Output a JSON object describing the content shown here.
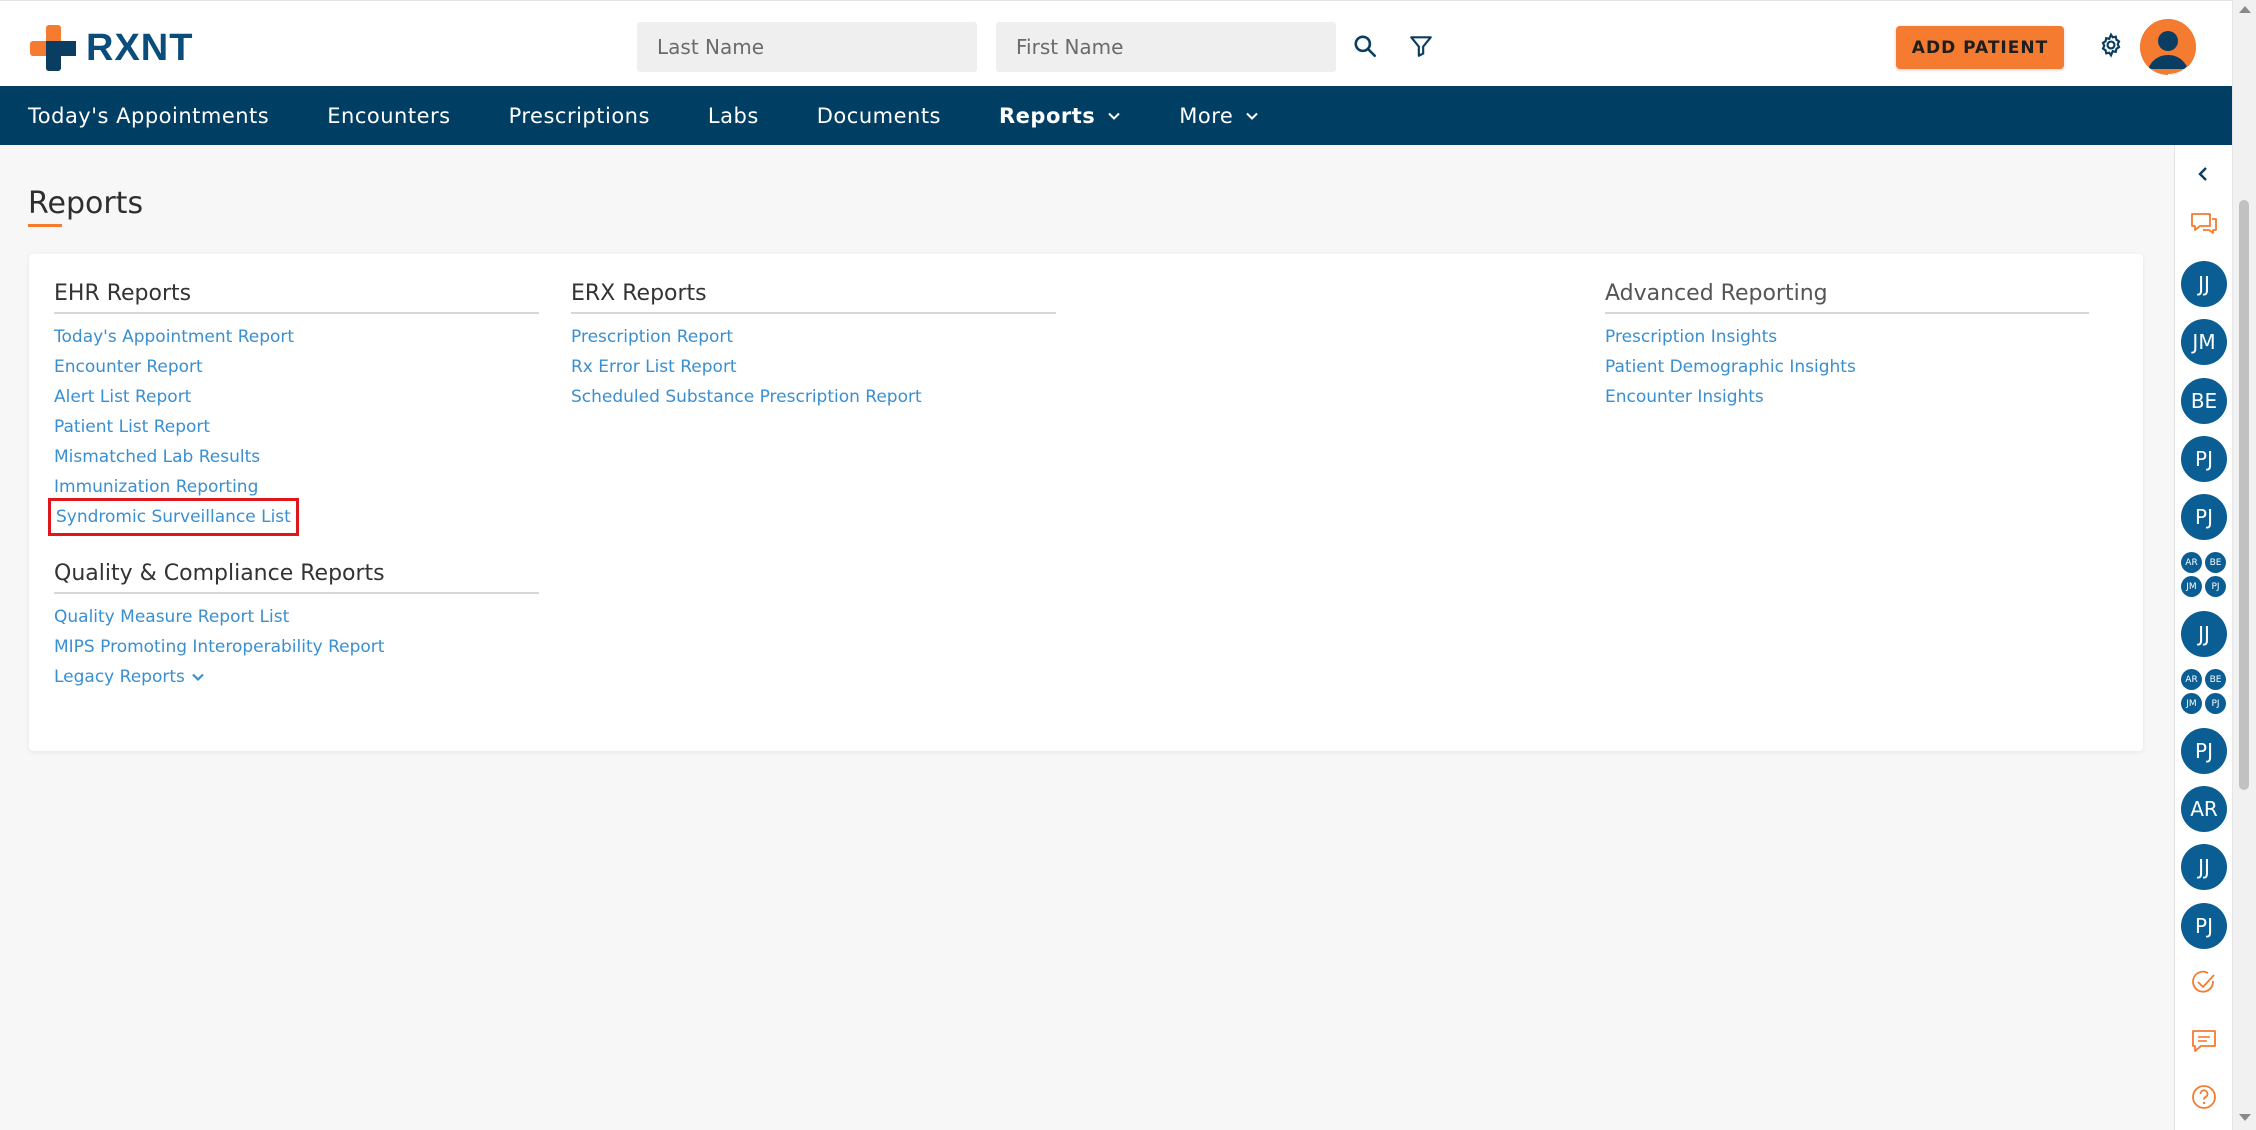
{
  "brand": {
    "name": "RXNT"
  },
  "header": {
    "last_name_placeholder": "Last Name",
    "first_name_placeholder": "First Name",
    "add_patient_label": "ADD PATIENT"
  },
  "nav": {
    "items": [
      {
        "label": "Today's Appointments"
      },
      {
        "label": "Encounters"
      },
      {
        "label": "Prescriptions"
      },
      {
        "label": "Labs"
      },
      {
        "label": "Documents"
      },
      {
        "label": "Reports"
      },
      {
        "label": "More"
      }
    ],
    "active": "Reports"
  },
  "page": {
    "title": "Reports"
  },
  "reports": {
    "ehr": {
      "title": "EHR Reports",
      "links": [
        "Today's Appointment Report",
        "Encounter Report",
        "Alert List Report",
        "Patient List Report",
        "Mismatched Lab Results",
        "Immunization Reporting",
        "Syndromic Surveillance List"
      ]
    },
    "erx": {
      "title": "ERX Reports",
      "links": [
        "Prescription Report",
        "Rx Error List Report",
        "Scheduled Substance Prescription Report"
      ]
    },
    "advanced": {
      "title": "Advanced Reporting",
      "links": [
        "Prescription Insights",
        "Patient Demographic Insights",
        "Encounter Insights"
      ]
    },
    "quality": {
      "title": "Quality & Compliance Reports",
      "links": [
        "Quality Measure Report List",
        "MIPS Promoting Interoperability Report",
        "Legacy Reports"
      ]
    }
  },
  "rail": {
    "avatars": [
      "JJ",
      "JM",
      "BE",
      "PJ",
      "PJ",
      "JJ",
      "PJ",
      "AR",
      "JJ",
      "PJ"
    ],
    "group": [
      "AR",
      "BE",
      "JM",
      "PJ"
    ]
  },
  "colors": {
    "accent": "#f47b30",
    "nav": "#003f63",
    "link": "#3a8fd0",
    "avatar": "#0a5e94",
    "highlight": "#e0161d"
  }
}
